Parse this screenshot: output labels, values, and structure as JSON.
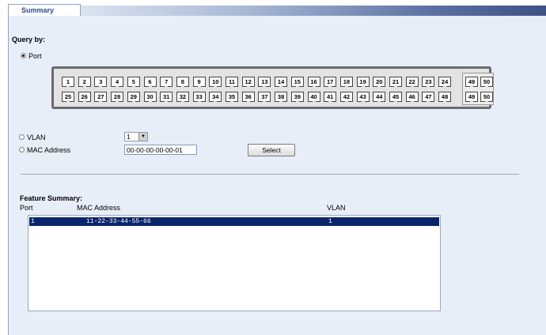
{
  "tab": {
    "label": "Summary"
  },
  "query": {
    "heading": "Query by:",
    "port_option": "Port",
    "vlan_option": "VLAN",
    "mac_option": "MAC Address",
    "vlan_value": "1",
    "mac_value": "00-00-00-00-00-01",
    "select_button": "Select"
  },
  "ports": {
    "top": [
      "1",
      "2",
      "3",
      "4",
      "5",
      "6",
      "7",
      "8",
      "9",
      "10",
      "11",
      "12",
      "13",
      "14",
      "15",
      "16",
      "17",
      "18",
      "19",
      "20",
      "21",
      "22",
      "23",
      "24"
    ],
    "bottom": [
      "25",
      "26",
      "27",
      "28",
      "29",
      "30",
      "31",
      "32",
      "33",
      "34",
      "35",
      "36",
      "37",
      "38",
      "39",
      "40",
      "41",
      "42",
      "43",
      "44",
      "45",
      "46",
      "47",
      "48"
    ],
    "uplink_top": [
      "49",
      "50"
    ],
    "uplink_bottom": [
      "49",
      "50"
    ]
  },
  "summary": {
    "heading": "Feature Summary:",
    "columns": [
      "Port",
      "MAC Address",
      "VLAN"
    ],
    "rows": [
      {
        "port": "1",
        "mac": "11-22-33-44-55-66",
        "vlan": "1"
      }
    ]
  },
  "colors": {
    "panel_bg": "#e8eef8",
    "selected_row": "#0a246a",
    "tab_text": "#2c4a88"
  }
}
